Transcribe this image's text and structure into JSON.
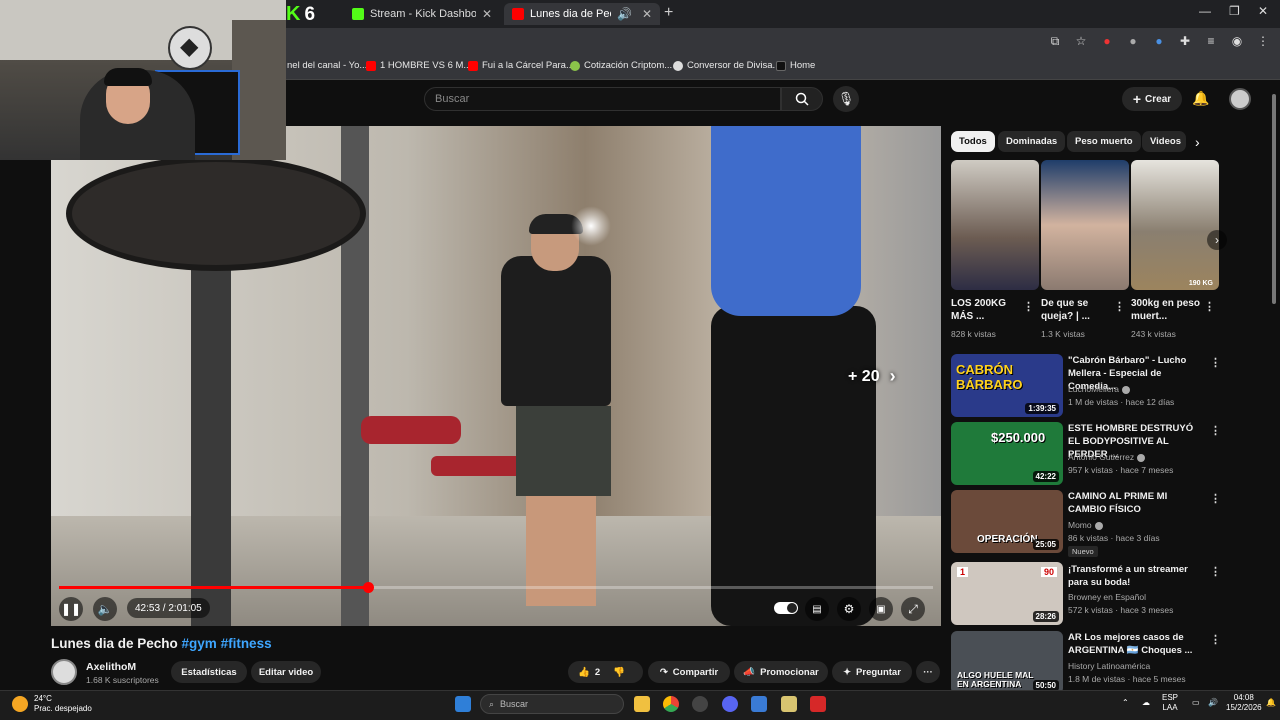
{
  "browser": {
    "kick_badge": "6",
    "tabs": [
      {
        "title": "Stream - Kick Dashboard",
        "fav_color": "#53fc18"
      },
      {
        "title": "Lunes dia de Pecho #gym #",
        "fav_color": "#ff0000"
      }
    ],
    "bookmarks": [
      {
        "label": "nel del canal - Yo...",
        "color": "#ff0000"
      },
      {
        "label": "1 HOMBRE VS 6 M...",
        "color": "#ff0000"
      },
      {
        "label": "Fui a la Cárcel Para...",
        "color": "#ff0000"
      },
      {
        "label": "Cotización Criptom...",
        "color": "#8bc34a"
      },
      {
        "label": "Conversor de Divisa...",
        "color": "#dddddd"
      },
      {
        "label": "Home",
        "color": "#222222"
      }
    ]
  },
  "youtube": {
    "search_placeholder": "Buscar",
    "create_label": "Crear",
    "video": {
      "title": "Lunes dia de Pecho",
      "tags": "#gym #fitness",
      "time": "42:53 / 2:01:05",
      "progress": 0.354,
      "buffered": 0.36,
      "skip_label": "+ 20"
    },
    "channel": {
      "name": "AxelithoM",
      "subs": "1.68 K suscriptores"
    },
    "actions": {
      "stats": "Estadísticas",
      "edit": "Editar video",
      "likes": "2",
      "share": "Compartir",
      "promote": "Promocionar",
      "ask": "Preguntar"
    },
    "chips": [
      "Todos",
      "Dominadas",
      "Peso muerto",
      "Videos"
    ],
    "shorts": [
      {
        "title": "LOS 200KG MÁS ...",
        "views": "828 k vistas"
      },
      {
        "title": "De que se queja? | ...",
        "views": "1.3 K vistas"
      },
      {
        "title": "300kg en peso muert...",
        "views": "243 k vistas",
        "overlay": "190 KG"
      }
    ],
    "recommended": [
      {
        "title": "\"Cabrón Bárbaro\" - Lucho Mellera - Especial de Comedia...",
        "channel": "LuchoMellera",
        "meta": "1 M de vistas · hace 12 días",
        "duration": "1:39:35",
        "thumb_text": "CABRÓN BÁRBARO",
        "thumb_color": "#2a3a8a"
      },
      {
        "title": "ESTE HOMBRE DESTRUYÓ EL BODYPOSITIVE AL PERDER ...",
        "channel": "Antonio Gutiérrez",
        "meta": "957 k vistas · hace 7 meses",
        "duration": "42:22",
        "thumb_text": "$250.000",
        "thumb_color": "#1f7a3a"
      },
      {
        "title": "CAMINO AL PRIME MI CAMBIO FÍSICO",
        "channel": "Momo",
        "meta": "86 k vistas · hace 3 días",
        "duration": "25:05",
        "thumb_text": "OPERACIÓN",
        "thumb_color": "#6b4a3a",
        "badge": "Nuevo"
      },
      {
        "title": "¡Transformé a un streamer para su boda!",
        "channel": "Browney en Español",
        "meta": "572 k vistas · hace 3 meses",
        "duration": "28:26",
        "thumb_text": "",
        "thumb_color": "#cfc7bf",
        "numbers": [
          "1",
          "90"
        ]
      },
      {
        "title": "AR Los mejores casos de ARGENTINA 🇦🇷 Choques ...",
        "channel": "History Latinoamérica",
        "meta": "1.8 M de vistas · hace 5 meses",
        "duration": "50:50",
        "thumb_text": "ALGO HUELE MAL EN ARGENTINA",
        "thumb_color": "#4a4f55"
      }
    ]
  },
  "taskbar": {
    "temp": "24°C",
    "weather": "Prac. despejado",
    "search": "Buscar",
    "lang1": "ESP",
    "lang2": "LAA",
    "time": "04:08",
    "date": "15/2/2026"
  }
}
